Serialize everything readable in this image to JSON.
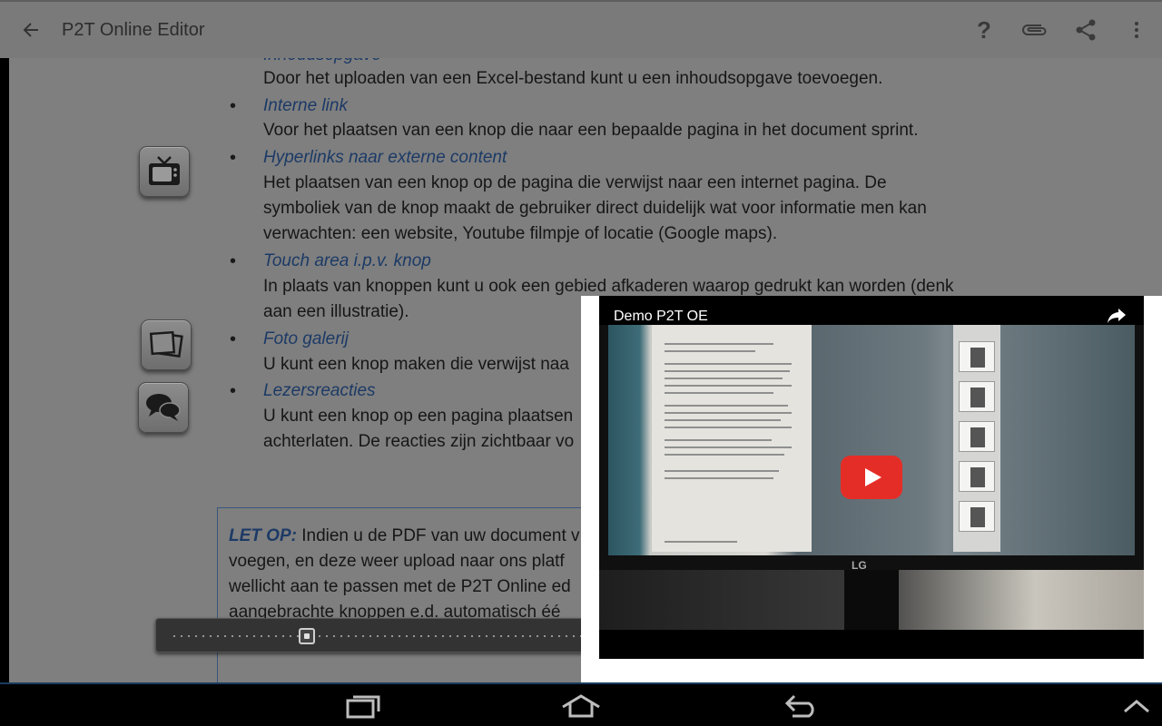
{
  "appbar": {
    "title": "P2T Online Editor",
    "help_label": "?",
    "icons": [
      "back-arrow-icon",
      "help-icon",
      "attachment-icon",
      "share-icon",
      "overflow-menu-icon"
    ]
  },
  "document": {
    "items": [
      {
        "heading": "Inhoudsopgave",
        "lines": [
          "Door het uploaden van een Excel-bestand kunt u een inhoudsopgave toevoegen."
        ]
      },
      {
        "heading": "Interne link",
        "lines": [
          "Voor het plaatsen van een knop die naar een bepaalde pagina in het document sprint."
        ]
      },
      {
        "heading": "Hyperlinks naar externe content",
        "lines": [
          "Het plaatsen van een knop op de pagina die verwijst naar een internet pagina. De",
          "symboliek van de knop maakt de gebruiker direct duidelijk wat voor informatie men kan",
          "verwachten: een website, Youtube filmpje of locatie (Google maps)."
        ]
      },
      {
        "heading": "Touch area i.p.v. knop",
        "lines": [
          "In plaats van knoppen kunt u ook een gebied afkaderen waarop gedrukt kan worden (denk",
          "aan een illustratie)."
        ]
      },
      {
        "heading": "Foto galerij",
        "lines": [
          "U kunt een knop maken die verwijst naa"
        ]
      },
      {
        "heading": "Lezersreacties",
        "lines": [
          "U kunt een knop op een pagina plaatsen",
          "achterlaten. De reacties zijn zichtbaar vo"
        ]
      }
    ],
    "bullet": "•",
    "note": {
      "label": "LET OP:",
      "line1_rest": " Indien u de PDF van uw document v",
      "line2": "voegen, en deze weer upload naar ons platf",
      "line3": "wellicht aan te passen met de P2T Online ed",
      "line4": "aangebrachte knoppen e.d. automatisch éé"
    },
    "side_buttons": [
      "tv-icon",
      "photo-gallery-icon",
      "chat-bubbles-icon"
    ],
    "page_slider_position": 0.3
  },
  "video": {
    "title": "Demo P2T OE",
    "brand_on_monitor": "LG",
    "icons": [
      "share-arrow-icon",
      "youtube-play-icon"
    ],
    "play_color": "#e52d27"
  },
  "navbar": {
    "icons": [
      "recent-apps-icon",
      "home-icon",
      "back-icon",
      "chevron-up-icon"
    ]
  }
}
